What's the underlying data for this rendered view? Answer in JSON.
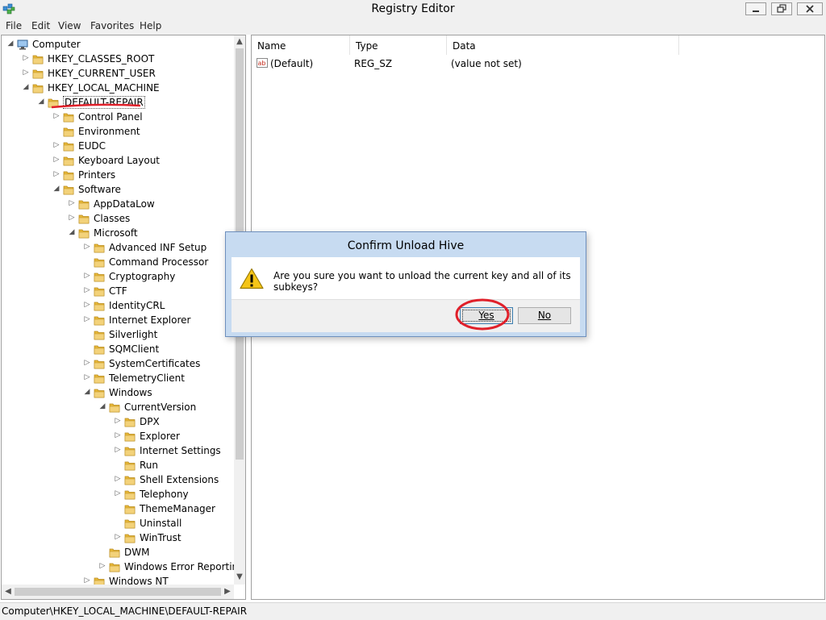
{
  "window": {
    "title": "Registry Editor",
    "icon": "registry-icon"
  },
  "menu": [
    "File",
    "Edit",
    "View",
    "Favorites",
    "Help"
  ],
  "tree": [
    {
      "label": "Computer",
      "level": 0,
      "expander": "expanded",
      "icon": "computer-icon"
    },
    {
      "label": "HKEY_CLASSES_ROOT",
      "level": 1,
      "expander": "collapsed"
    },
    {
      "label": "HKEY_CURRENT_USER",
      "level": 1,
      "expander": "collapsed"
    },
    {
      "label": "HKEY_LOCAL_MACHINE",
      "level": 1,
      "expander": "expanded"
    },
    {
      "label": "DEFAULT-REPAIR",
      "level": 2,
      "expander": "expanded",
      "selected": true,
      "annotated": true
    },
    {
      "label": "Control Panel",
      "level": 3,
      "expander": "collapsed"
    },
    {
      "label": "Environment",
      "level": 3,
      "expander": "none"
    },
    {
      "label": "EUDC",
      "level": 3,
      "expander": "collapsed"
    },
    {
      "label": "Keyboard Layout",
      "level": 3,
      "expander": "collapsed"
    },
    {
      "label": "Printers",
      "level": 3,
      "expander": "collapsed"
    },
    {
      "label": "Software",
      "level": 3,
      "expander": "expanded"
    },
    {
      "label": "AppDataLow",
      "level": 4,
      "expander": "collapsed"
    },
    {
      "label": "Classes",
      "level": 4,
      "expander": "collapsed"
    },
    {
      "label": "Microsoft",
      "level": 4,
      "expander": "expanded"
    },
    {
      "label": "Advanced INF Setup",
      "level": 5,
      "expander": "collapsed"
    },
    {
      "label": "Command Processor",
      "level": 5,
      "expander": "none"
    },
    {
      "label": "Cryptography",
      "level": 5,
      "expander": "collapsed"
    },
    {
      "label": "CTF",
      "level": 5,
      "expander": "collapsed"
    },
    {
      "label": "IdentityCRL",
      "level": 5,
      "expander": "collapsed"
    },
    {
      "label": "Internet Explorer",
      "level": 5,
      "expander": "collapsed"
    },
    {
      "label": "Silverlight",
      "level": 5,
      "expander": "none"
    },
    {
      "label": "SQMClient",
      "level": 5,
      "expander": "none"
    },
    {
      "label": "SystemCertificates",
      "level": 5,
      "expander": "collapsed"
    },
    {
      "label": "TelemetryClient",
      "level": 5,
      "expander": "collapsed"
    },
    {
      "label": "Windows",
      "level": 5,
      "expander": "expanded"
    },
    {
      "label": "CurrentVersion",
      "level": 6,
      "expander": "expanded"
    },
    {
      "label": "DPX",
      "level": 7,
      "expander": "collapsed"
    },
    {
      "label": "Explorer",
      "level": 7,
      "expander": "collapsed"
    },
    {
      "label": "Internet Settings",
      "level": 7,
      "expander": "collapsed"
    },
    {
      "label": "Run",
      "level": 7,
      "expander": "none"
    },
    {
      "label": "Shell Extensions",
      "level": 7,
      "expander": "collapsed"
    },
    {
      "label": "Telephony",
      "level": 7,
      "expander": "collapsed"
    },
    {
      "label": "ThemeManager",
      "level": 7,
      "expander": "none"
    },
    {
      "label": "Uninstall",
      "level": 7,
      "expander": "none"
    },
    {
      "label": "WinTrust",
      "level": 7,
      "expander": "collapsed"
    },
    {
      "label": "DWM",
      "level": 6,
      "expander": "none"
    },
    {
      "label": "Windows Error Reporting",
      "level": 6,
      "expander": "collapsed"
    },
    {
      "label": "Windows NT",
      "level": 5,
      "expander": "collapsed"
    }
  ],
  "list": {
    "columns": [
      "Name",
      "Type",
      "Data"
    ],
    "rows": [
      {
        "icon": "string-value-icon",
        "name": "(Default)",
        "type": "REG_SZ",
        "data": "(value not set)"
      }
    ]
  },
  "status": "Computer\\HKEY_LOCAL_MACHINE\\DEFAULT-REPAIR",
  "dialog": {
    "title": "Confirm Unload Hive",
    "icon": "warning-icon",
    "message": "Are you sure you want to unload the current key and all of its subkeys?",
    "yes_label": "Yes",
    "no_label": "No",
    "yes_annotated": true
  },
  "colors": {
    "annotation": "#e0202a",
    "folder": "#e8b93a",
    "dialog_frame": "#c7dbf1"
  }
}
